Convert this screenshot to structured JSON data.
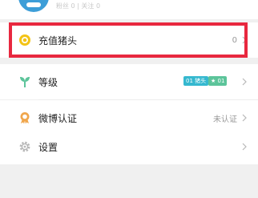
{
  "profile": {
    "subtitle": "粉丝 0 | 关注 0"
  },
  "menu": {
    "recharge": {
      "label": "充值猪头",
      "value": "0"
    },
    "level": {
      "label": "等级",
      "badge_primary": "01 猪头",
      "badge_secondary": "★ 01"
    },
    "weibo": {
      "label": "微博认证",
      "value": "未认证"
    },
    "settings": {
      "label": "设置"
    }
  },
  "colors": {
    "highlight": "#e8283f",
    "recharge_icon": "#f3c316",
    "level_icon": "#5cc49a",
    "weibo_icon": "#f0a64c",
    "badge_primary": "#35b8cf",
    "badge_secondary": "#5cc49a"
  },
  "icons": {
    "recharge": "coin-icon",
    "level": "sprout-icon",
    "weibo": "badge-ribbon-icon",
    "settings": "gear-icon",
    "chevron": "chevron-right-icon"
  }
}
